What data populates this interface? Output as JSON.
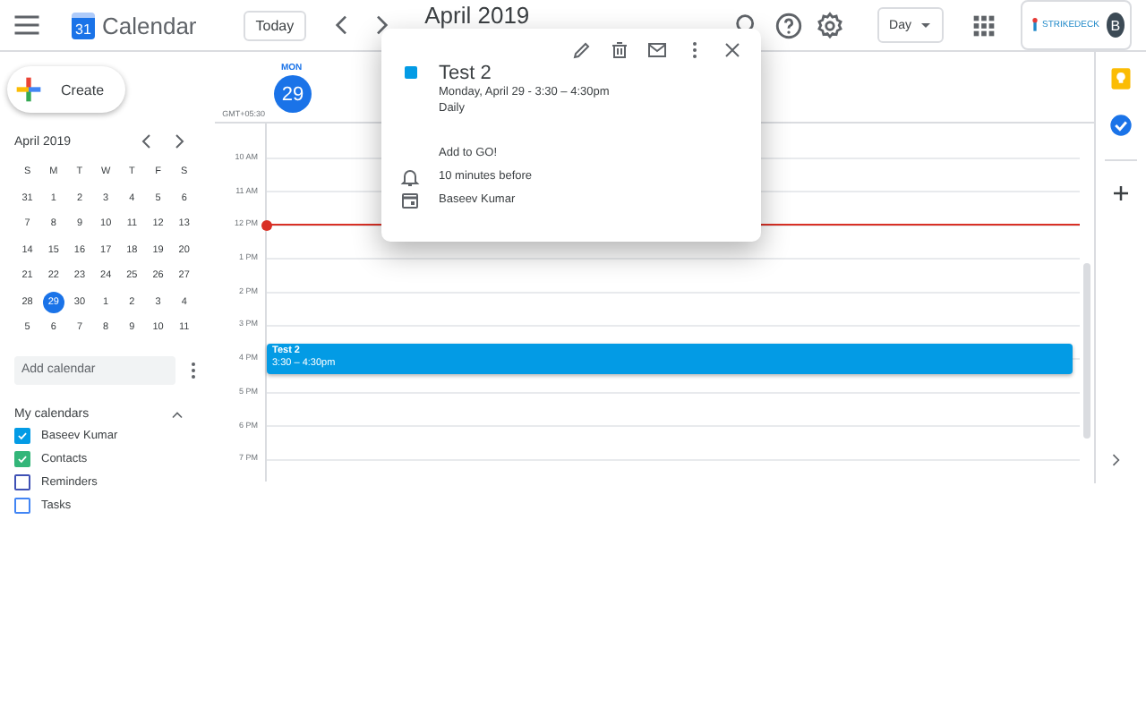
{
  "header": {
    "logo_day": "31",
    "app_name": "Calendar",
    "today_button": "Today",
    "title": "April 2019",
    "view": "Day",
    "brand": "STRIKEDECK",
    "avatar": "B"
  },
  "sidebar": {
    "create": "Create",
    "mini_calendar": {
      "title": "April 2019",
      "weekdays": [
        "S",
        "M",
        "T",
        "W",
        "T",
        "F",
        "S"
      ],
      "weeks": [
        [
          {
            "day": "31",
            "selected": false
          },
          {
            "day": "1",
            "selected": false
          },
          {
            "day": "2",
            "selected": false
          },
          {
            "day": "3",
            "selected": false
          },
          {
            "day": "4",
            "selected": false
          },
          {
            "day": "5",
            "selected": false
          },
          {
            "day": "6",
            "selected": false
          }
        ],
        [
          {
            "day": "7",
            "selected": false
          },
          {
            "day": "8",
            "selected": false
          },
          {
            "day": "9",
            "selected": false
          },
          {
            "day": "10",
            "selected": false
          },
          {
            "day": "11",
            "selected": false
          },
          {
            "day": "12",
            "selected": false
          },
          {
            "day": "13",
            "selected": false
          }
        ],
        [
          {
            "day": "14",
            "selected": false
          },
          {
            "day": "15",
            "selected": false
          },
          {
            "day": "16",
            "selected": false
          },
          {
            "day": "17",
            "selected": false
          },
          {
            "day": "18",
            "selected": false
          },
          {
            "day": "19",
            "selected": false
          },
          {
            "day": "20",
            "selected": false
          }
        ],
        [
          {
            "day": "21",
            "selected": false
          },
          {
            "day": "22",
            "selected": false
          },
          {
            "day": "23",
            "selected": false
          },
          {
            "day": "24",
            "selected": false
          },
          {
            "day": "25",
            "selected": false
          },
          {
            "day": "26",
            "selected": false
          },
          {
            "day": "27",
            "selected": false
          }
        ],
        [
          {
            "day": "28",
            "selected": false
          },
          {
            "day": "29",
            "selected": true
          },
          {
            "day": "30",
            "selected": false
          },
          {
            "day": "1",
            "selected": false
          },
          {
            "day": "2",
            "selected": false
          },
          {
            "day": "3",
            "selected": false
          },
          {
            "day": "4",
            "selected": false
          }
        ],
        [
          {
            "day": "5",
            "selected": false
          },
          {
            "day": "6",
            "selected": false
          },
          {
            "day": "7",
            "selected": false
          },
          {
            "day": "8",
            "selected": false
          },
          {
            "day": "9",
            "selected": false
          },
          {
            "day": "10",
            "selected": false
          },
          {
            "day": "11",
            "selected": false
          }
        ]
      ]
    },
    "add_calendar": {
      "placeholder": "Add calendar"
    },
    "my_calendars": {
      "title": "My calendars",
      "expanded": true,
      "items": [
        {
          "name": "Baseev Kumar",
          "checked": true,
          "color": "#039be5"
        },
        {
          "name": "Contacts",
          "checked": true,
          "color": "#33b679"
        },
        {
          "name": "Reminders",
          "checked": false,
          "color": "#3f51b5"
        },
        {
          "name": "Tasks",
          "checked": false,
          "color": "#4285f4"
        }
      ]
    }
  },
  "day": {
    "weekday": "MON",
    "date": "29",
    "timezone": "GMT+05:30",
    "hours": [
      "10 AM",
      "11 AM",
      "12 PM",
      "1 PM",
      "2 PM",
      "3 PM",
      "4 PM",
      "5 PM",
      "6 PM",
      "7 PM"
    ],
    "events": [
      {
        "title": "Test 2",
        "time": "3:30 – 4:30pm",
        "color": "#039be5"
      }
    ]
  },
  "popup": {
    "title": "Test 2",
    "color": "#039be5",
    "when": "Monday, April 29  -  3:30 – 4:30pm",
    "recurrence": "Daily",
    "link": "Add to GO!",
    "reminder": "10 minutes before",
    "calendar": "Baseev Kumar"
  }
}
